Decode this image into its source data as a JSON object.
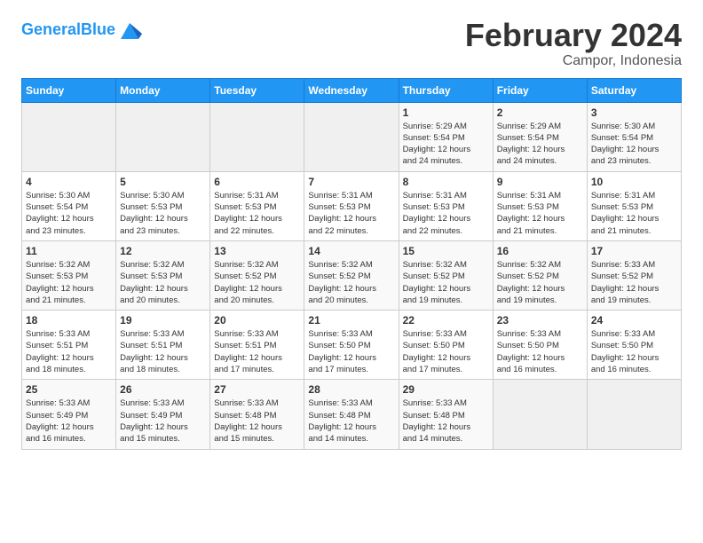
{
  "header": {
    "logo_text_general": "General",
    "logo_text_blue": "Blue",
    "main_title": "February 2024",
    "subtitle": "Campor, Indonesia"
  },
  "calendar": {
    "days_of_week": [
      "Sunday",
      "Monday",
      "Tuesday",
      "Wednesday",
      "Thursday",
      "Friday",
      "Saturday"
    ],
    "weeks": [
      {
        "days": [
          {
            "num": "",
            "info": ""
          },
          {
            "num": "",
            "info": ""
          },
          {
            "num": "",
            "info": ""
          },
          {
            "num": "",
            "info": ""
          },
          {
            "num": "1",
            "info": "Sunrise: 5:29 AM\nSunset: 5:54 PM\nDaylight: 12 hours\nand 24 minutes."
          },
          {
            "num": "2",
            "info": "Sunrise: 5:29 AM\nSunset: 5:54 PM\nDaylight: 12 hours\nand 24 minutes."
          },
          {
            "num": "3",
            "info": "Sunrise: 5:30 AM\nSunset: 5:54 PM\nDaylight: 12 hours\nand 23 minutes."
          }
        ]
      },
      {
        "days": [
          {
            "num": "4",
            "info": "Sunrise: 5:30 AM\nSunset: 5:54 PM\nDaylight: 12 hours\nand 23 minutes."
          },
          {
            "num": "5",
            "info": "Sunrise: 5:30 AM\nSunset: 5:53 PM\nDaylight: 12 hours\nand 23 minutes."
          },
          {
            "num": "6",
            "info": "Sunrise: 5:31 AM\nSunset: 5:53 PM\nDaylight: 12 hours\nand 22 minutes."
          },
          {
            "num": "7",
            "info": "Sunrise: 5:31 AM\nSunset: 5:53 PM\nDaylight: 12 hours\nand 22 minutes."
          },
          {
            "num": "8",
            "info": "Sunrise: 5:31 AM\nSunset: 5:53 PM\nDaylight: 12 hours\nand 22 minutes."
          },
          {
            "num": "9",
            "info": "Sunrise: 5:31 AM\nSunset: 5:53 PM\nDaylight: 12 hours\nand 21 minutes."
          },
          {
            "num": "10",
            "info": "Sunrise: 5:31 AM\nSunset: 5:53 PM\nDaylight: 12 hours\nand 21 minutes."
          }
        ]
      },
      {
        "days": [
          {
            "num": "11",
            "info": "Sunrise: 5:32 AM\nSunset: 5:53 PM\nDaylight: 12 hours\nand 21 minutes."
          },
          {
            "num": "12",
            "info": "Sunrise: 5:32 AM\nSunset: 5:53 PM\nDaylight: 12 hours\nand 20 minutes."
          },
          {
            "num": "13",
            "info": "Sunrise: 5:32 AM\nSunset: 5:52 PM\nDaylight: 12 hours\nand 20 minutes."
          },
          {
            "num": "14",
            "info": "Sunrise: 5:32 AM\nSunset: 5:52 PM\nDaylight: 12 hours\nand 20 minutes."
          },
          {
            "num": "15",
            "info": "Sunrise: 5:32 AM\nSunset: 5:52 PM\nDaylight: 12 hours\nand 19 minutes."
          },
          {
            "num": "16",
            "info": "Sunrise: 5:32 AM\nSunset: 5:52 PM\nDaylight: 12 hours\nand 19 minutes."
          },
          {
            "num": "17",
            "info": "Sunrise: 5:33 AM\nSunset: 5:52 PM\nDaylight: 12 hours\nand 19 minutes."
          }
        ]
      },
      {
        "days": [
          {
            "num": "18",
            "info": "Sunrise: 5:33 AM\nSunset: 5:51 PM\nDaylight: 12 hours\nand 18 minutes."
          },
          {
            "num": "19",
            "info": "Sunrise: 5:33 AM\nSunset: 5:51 PM\nDaylight: 12 hours\nand 18 minutes."
          },
          {
            "num": "20",
            "info": "Sunrise: 5:33 AM\nSunset: 5:51 PM\nDaylight: 12 hours\nand 17 minutes."
          },
          {
            "num": "21",
            "info": "Sunrise: 5:33 AM\nSunset: 5:50 PM\nDaylight: 12 hours\nand 17 minutes."
          },
          {
            "num": "22",
            "info": "Sunrise: 5:33 AM\nSunset: 5:50 PM\nDaylight: 12 hours\nand 17 minutes."
          },
          {
            "num": "23",
            "info": "Sunrise: 5:33 AM\nSunset: 5:50 PM\nDaylight: 12 hours\nand 16 minutes."
          },
          {
            "num": "24",
            "info": "Sunrise: 5:33 AM\nSunset: 5:50 PM\nDaylight: 12 hours\nand 16 minutes."
          }
        ]
      },
      {
        "days": [
          {
            "num": "25",
            "info": "Sunrise: 5:33 AM\nSunset: 5:49 PM\nDaylight: 12 hours\nand 16 minutes."
          },
          {
            "num": "26",
            "info": "Sunrise: 5:33 AM\nSunset: 5:49 PM\nDaylight: 12 hours\nand 15 minutes."
          },
          {
            "num": "27",
            "info": "Sunrise: 5:33 AM\nSunset: 5:48 PM\nDaylight: 12 hours\nand 15 minutes."
          },
          {
            "num": "28",
            "info": "Sunrise: 5:33 AM\nSunset: 5:48 PM\nDaylight: 12 hours\nand 14 minutes."
          },
          {
            "num": "29",
            "info": "Sunrise: 5:33 AM\nSunset: 5:48 PM\nDaylight: 12 hours\nand 14 minutes."
          },
          {
            "num": "",
            "info": ""
          },
          {
            "num": "",
            "info": ""
          }
        ]
      }
    ]
  }
}
